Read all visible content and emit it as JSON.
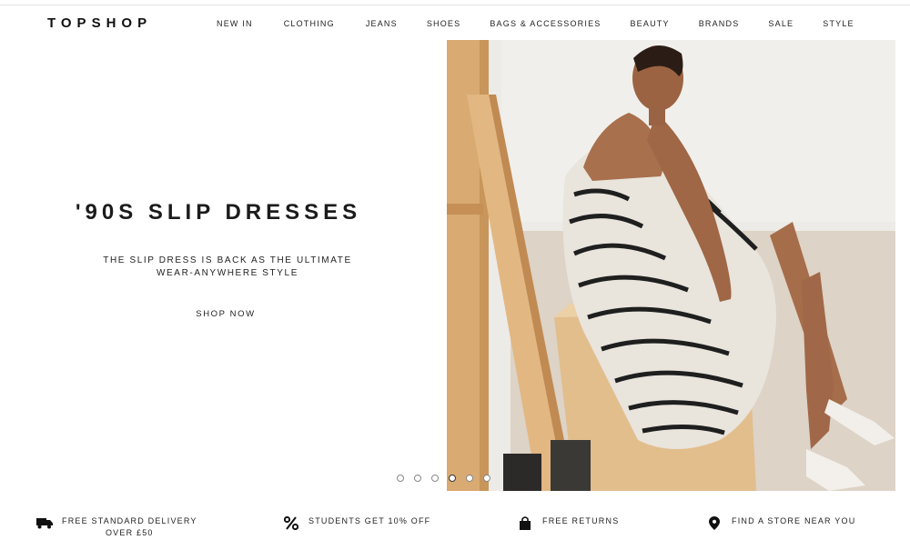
{
  "header": {
    "logo": "TOPSHOP",
    "nav": [
      {
        "label": "NEW IN"
      },
      {
        "label": "CLOTHING"
      },
      {
        "label": "JEANS"
      },
      {
        "label": "SHOES"
      },
      {
        "label": "BAGS & ACCESSORIES"
      },
      {
        "label": "BEAUTY"
      },
      {
        "label": "BRANDS"
      },
      {
        "label": "SALE"
      },
      {
        "label": "STYLE"
      }
    ]
  },
  "hero": {
    "title": "'90S SLIP DRESSES",
    "subtitle_line1": "THE SLIP DRESS IS BACK AS THE ULTIMATE",
    "subtitle_line2": "WEAR-ANYWHERE STYLE",
    "cta": "SHOP NOW",
    "carousel": {
      "total_slides": 6,
      "active_slide": 4
    }
  },
  "features": [
    {
      "icon": "delivery-truck-icon",
      "line1": "FREE STANDARD DELIVERY",
      "line2": "OVER £50"
    },
    {
      "icon": "percent-icon",
      "line1": "STUDENTS GET 10% OFF"
    },
    {
      "icon": "shopping-bag-icon",
      "line1": "FREE RETURNS"
    },
    {
      "icon": "location-pin-icon",
      "line1": "FIND A STORE NEAR YOU"
    }
  ]
}
